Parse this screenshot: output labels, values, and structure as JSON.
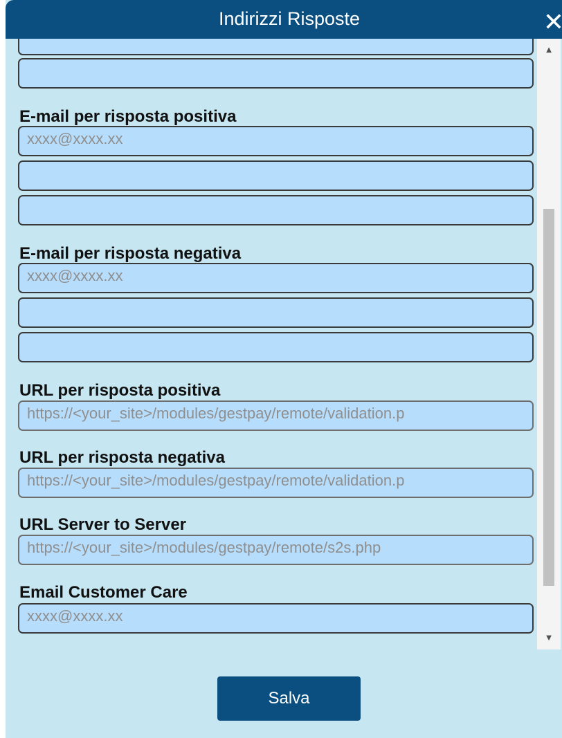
{
  "dialog": {
    "title": "Indirizzi Risposte",
    "close_label": "✕",
    "save_label": "Salva"
  },
  "colors": {
    "title_bar": "#0a4f80",
    "dialog_background": "#c6e6f1",
    "field_background": "#b7ddfc",
    "save_button": "#0a4f80"
  },
  "icons": [
    "close-icon",
    "scroll-up-arrow-icon",
    "scroll-down-arrow-icon"
  ],
  "fields": {
    "positive_email_label": "E-mail per risposta positiva",
    "positive_email_placeholder": "xxxx@xxxx.xx",
    "negative_email_label": "E-mail per risposta negativa",
    "negative_email_placeholder": "xxxx@xxxx.xx",
    "url_positive_label": "URL per risposta positiva",
    "url_positive_value": "https://<your_site>/modules/gestpay/remote/validation.p",
    "url_negative_label": "URL per risposta negativa",
    "url_negative_value": "https://<your_site>/modules/gestpay/remote/validation.p",
    "url_s2s_label": "URL Server to Server",
    "url_s2s_value": "https://<your_site>/modules/gestpay/remote/s2s.php",
    "customer_care_label": "Email Customer Care",
    "customer_care_placeholder": "xxxx@xxxx.xx"
  }
}
